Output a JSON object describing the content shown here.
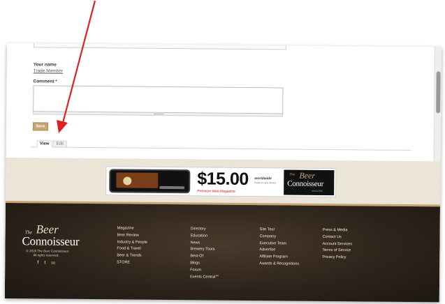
{
  "form": {
    "name_label": "Your name",
    "name_value": "Trade Member",
    "comment_label": "Comment",
    "comment_required": "*",
    "comment_value": "",
    "save_label": "Save"
  },
  "tabs": [
    {
      "label": "View",
      "active": true
    },
    {
      "label": "Edit",
      "active": false
    }
  ],
  "ad": {
    "price": "$15.00",
    "tagline": "Premium Web Magazine",
    "worldwide": "worldwide",
    "worldwide_sub": "Read on any device",
    "logo_the": "The",
    "logo_beer": "Beer",
    "logo_conn": "Connoisseur",
    "logo_mag": "MAGAZINE"
  },
  "footer": {
    "logo_the": "The",
    "logo_beer": "Beer",
    "logo_conn": "Connoisseur",
    "copyright_line1": "© 2016 The Beer Connoisseur.",
    "copyright_line2": "All rights reserved.",
    "social": {
      "facebook": "f",
      "twitter": "t",
      "email": "✉"
    },
    "columns": [
      [
        "Magazine",
        "Beer Review",
        "Industry & People",
        "Food & Travel",
        "Beer & Trends",
        "STORE"
      ],
      [
        "Directory",
        "Education",
        "News",
        "Brewery Tours",
        "Best-Of",
        "Blogs",
        "Forum",
        "Events Central℠"
      ],
      [
        "Site Tour",
        "Company",
        "Executive Team",
        "Advertise",
        "Affiliate Program",
        "Awards & Recognitions"
      ],
      [
        "Press & Media",
        "Contact Us",
        "Account Services",
        "Terms of Service",
        "Privacy Policy"
      ]
    ]
  },
  "colors": {
    "accent_gold": "#c7a472",
    "arrow_red": "#e02020",
    "footer_dark": "#2e241b",
    "banner_beige": "#ebe5d8"
  }
}
